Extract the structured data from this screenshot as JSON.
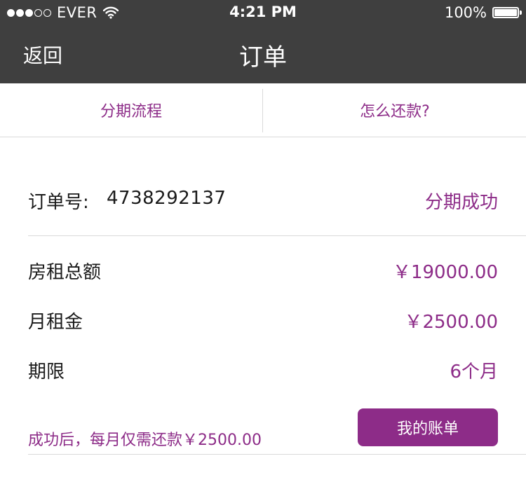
{
  "status_bar": {
    "signal_dots": [
      "filled",
      "filled",
      "filled",
      "empty",
      "empty"
    ],
    "carrier": "EVER",
    "time": "4:21 PM",
    "battery_percent": "100%",
    "battery_level": 1.0
  },
  "nav": {
    "back_label": "返回",
    "title": "订单"
  },
  "tabs": [
    {
      "label": "分期流程"
    },
    {
      "label": "怎么还款?"
    }
  ],
  "order": {
    "number_label": "订单号:",
    "number": "4738292137",
    "status": "分期成功",
    "details": [
      {
        "label": "房租总额",
        "value": "￥19000.00"
      },
      {
        "label": "月租金",
        "value": "￥2500.00"
      },
      {
        "label": "期限",
        "value": "6个月"
      }
    ],
    "footer_note": "成功后，每月仅需还款￥2500.00",
    "bill_button_label": "我的账单"
  },
  "colors": {
    "header_bg": "#3f3f3f",
    "accent": "#8d2c88",
    "divider": "#d9d9d9",
    "text": "#1a1a1a"
  },
  "icons": {
    "wifi": "wifi-icon",
    "battery": "battery-icon"
  }
}
